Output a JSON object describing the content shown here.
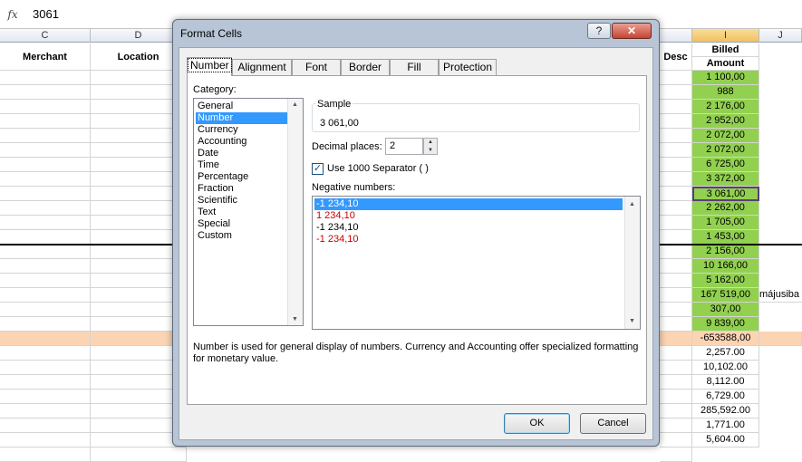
{
  "formula_bar": {
    "fx_label": "fx",
    "value": "3061"
  },
  "columns": {
    "C": "C",
    "D": "D",
    "I": "I",
    "J": "J"
  },
  "headers": {
    "merchant": "Merchant",
    "location": "Location",
    "desc": "Desc",
    "billed": "Billed",
    "amount": "Amount"
  },
  "billed_values": [
    "1 100,00",
    "988",
    "2 176,00",
    "2 952,00",
    "2 072,00",
    "2 072,00",
    "6 725,00",
    "3 372,00",
    "3 061,00",
    "2 262,00",
    "1 705,00",
    "1 453,00",
    "2 156,00",
    "10 166,00",
    "5 162,00",
    "167 519,00",
    "307,00",
    "9 839,00",
    "-653588,00",
    "2,257.00",
    "10,102.00",
    "8,112.00",
    "6,729.00",
    "285,592.00",
    "1,771.00",
    "5,604.00"
  ],
  "j_note": "májusiba",
  "dialog": {
    "title": "Format Cells",
    "help": "?",
    "close": "✕",
    "tabs": [
      "Number",
      "Alignment",
      "Font",
      "Border",
      "Fill",
      "Protection"
    ],
    "category_label": "Category:",
    "categories": [
      "General",
      "Number",
      "Currency",
      "Accounting",
      "Date",
      "Time",
      "Percentage",
      "Fraction",
      "Scientific",
      "Text",
      "Special",
      "Custom"
    ],
    "selected_category": "Number",
    "sample_label": "Sample",
    "sample_value": "3 061,00",
    "decimal_places_label": "Decimal places:",
    "decimal_places": "2",
    "separator_label": "Use 1000 Separator ( )",
    "separator_checked": true,
    "negative_label": "Negative numbers:",
    "negatives": [
      "-1 234,10",
      "1 234,10",
      "-1 234,10",
      "-1 234,10"
    ],
    "description": "Number is used for general display of numbers.  Currency and Accounting offer specialized formatting for monetary value.",
    "ok": "OK",
    "cancel": "Cancel"
  },
  "colors": {
    "green_fill": "#92d050",
    "peach_fill": "#fbd4b4",
    "selection": "#3399ff",
    "negative_red": "#cc0000"
  }
}
